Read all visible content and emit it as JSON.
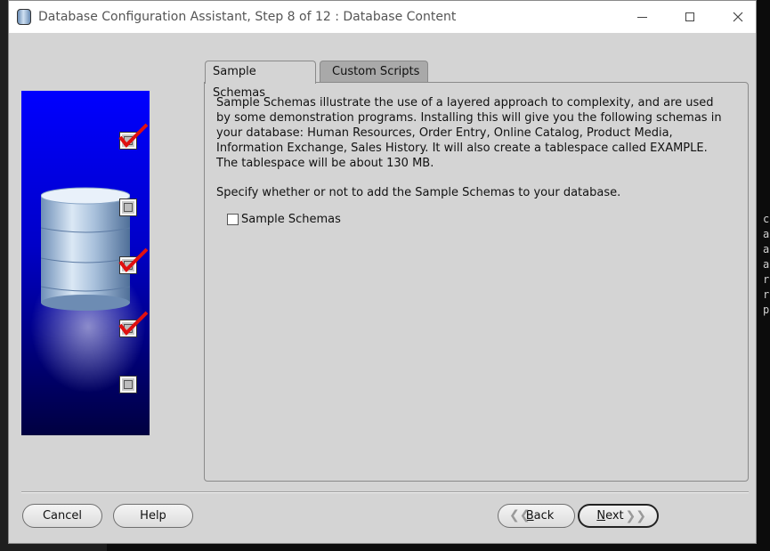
{
  "window": {
    "title": "Database Configuration Assistant, Step 8 of 12 : Database Content"
  },
  "side_steps": [
    {
      "state": "checked"
    },
    {
      "state": "unchecked"
    },
    {
      "state": "checked"
    },
    {
      "state": "checked"
    },
    {
      "state": "unchecked"
    }
  ],
  "tabs": [
    {
      "label": "Sample Schemas",
      "active": true
    },
    {
      "label": "Custom Scripts",
      "active": false
    }
  ],
  "panel": {
    "description": "Sample Schemas illustrate the use of a layered approach to complexity, and are used by some demonstration programs. Installing this will give you the following schemas in your database: Human Resources, Order Entry, Online Catalog, Product Media, Information Exchange, Sales History. It will also create a tablespace called EXAMPLE. The tablespace will be about 130 MB.",
    "specify": "Specify whether or not to add the Sample Schemas to your database.",
    "checkbox_label": "Sample Schemas",
    "checkbox_checked": false
  },
  "footer": {
    "cancel_label": "Cancel",
    "help_label": "Help",
    "back_label": "Back",
    "next_label": "Next"
  },
  "background_terminal": {
    "right_letters": [
      "c",
      "a",
      "a",
      "a",
      "r",
      "r",
      "p"
    ]
  },
  "colors": {
    "dialog_bg": "#d4d4d4",
    "graphic_top": "#0000ff",
    "graphic_bottom": "#000040",
    "check_red": "#e01010"
  }
}
